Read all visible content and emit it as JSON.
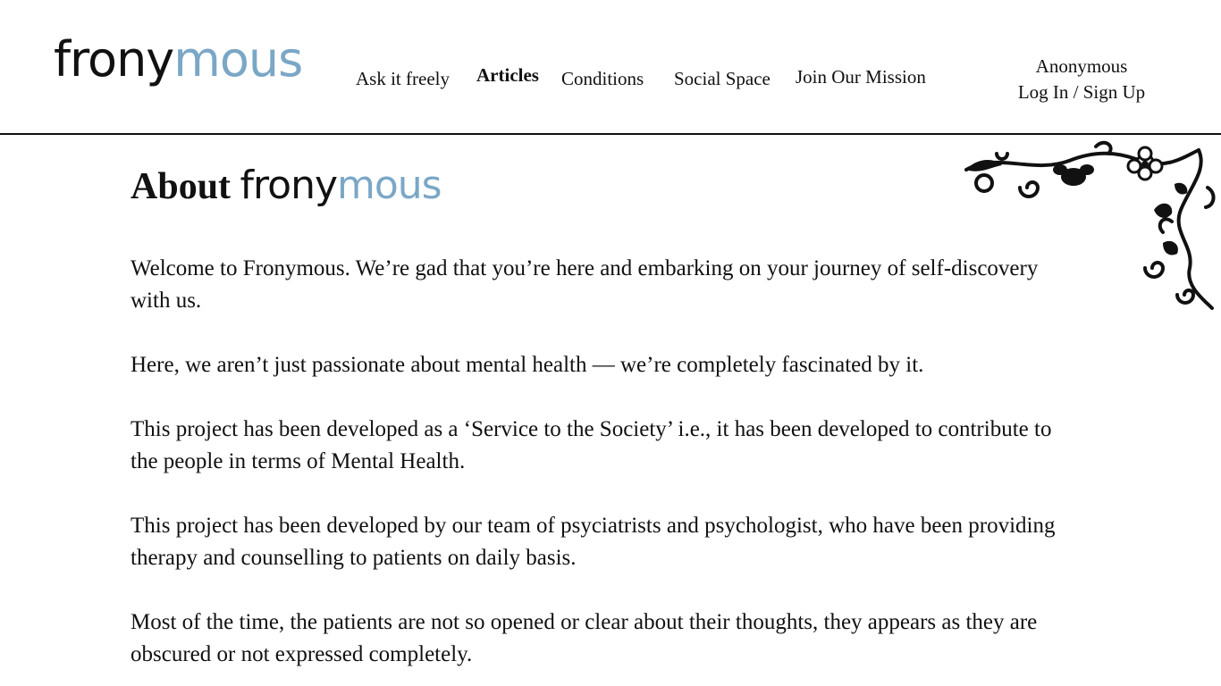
{
  "brand": {
    "logo_part1": "frony",
    "logo_part2": "mous",
    "logo_color_dark": "#111111",
    "logo_color_accent": "#7ba7c6"
  },
  "nav": {
    "items": [
      {
        "label": "Ask it freely"
      },
      {
        "label": "Articles"
      },
      {
        "label": "Conditions"
      },
      {
        "label": "Social Space"
      },
      {
        "label": "Join Our Mission"
      }
    ]
  },
  "user": {
    "name": "Anonymous",
    "auth_link": "Log In / Sign Up"
  },
  "ornament": {
    "icon": "floral-corner-ornament-icon"
  },
  "main": {
    "title_prefix": "About",
    "paragraphs": [
      "Welcome to Fronymous. We’re gad that you’re here and embarking on your journey of self-discovery with us.",
      "Here, we aren’t just passionate about mental health — we’re completely fascinated by it.",
      "This project has been developed as a ‘Service to the Society’ i.e., it has been developed to contribute to the people in terms of Mental Health.",
      "This project has been developed by our team of psyciatrists and psychologist, who have been providing therapy and counselling to patients on daily basis.",
      "Most of the time, the patients are not so opened or clear about their thoughts, they appears as they are obscured or not expressed completely."
    ]
  }
}
